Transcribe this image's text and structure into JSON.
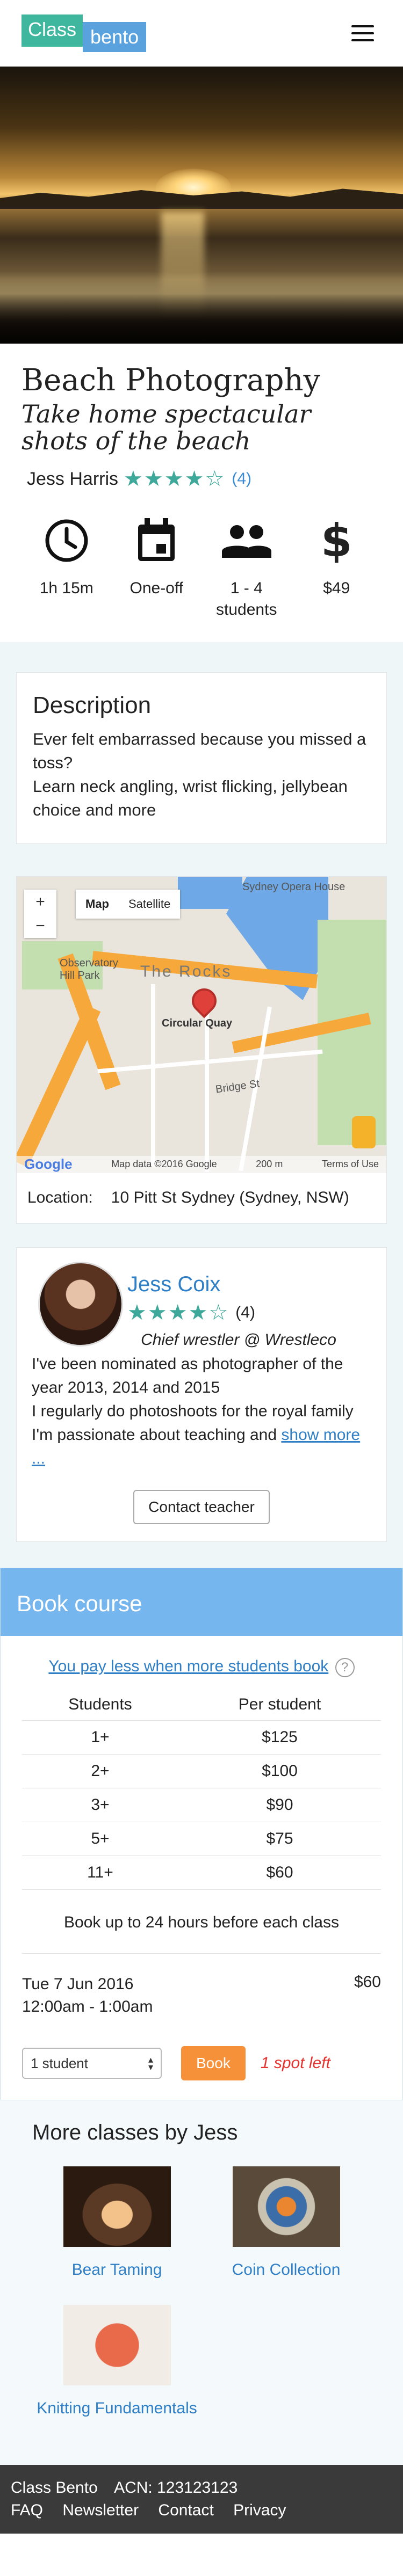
{
  "header": {
    "logo_part1": "Class",
    "logo_part2": "bento"
  },
  "course": {
    "title": "Beach Photography",
    "subtitle": "Take home spectacular shots of the beach",
    "teacher": "Jess Harris",
    "stars": "★★★★☆",
    "rating_count": "(4)"
  },
  "facts": [
    {
      "icon": "clock-icon",
      "text": "1h 15m"
    },
    {
      "icon": "calendar-icon",
      "text": "One-off"
    },
    {
      "icon": "people-icon",
      "text": "1 - 4 students"
    },
    {
      "icon": "dollar-icon",
      "text": "$49"
    }
  ],
  "description": {
    "heading": "Description",
    "text1": "Ever felt embarrassed because you missed a toss?",
    "text2": "Learn neck angling, wrist flicking, jellybean choice and more"
  },
  "map": {
    "type_map": "Map",
    "type_satellite": "Satellite",
    "labels": {
      "opera": "Sydney Opera House",
      "rocks": "The Rocks",
      "quay": "Circular Quay",
      "observatory": "Observatory Hill Park",
      "bridge": "Bridge St",
      "google": "Google",
      "data": "Map data ©2016 Google",
      "scale": "200 m",
      "terms": "Terms of Use"
    },
    "location_label": "Location:",
    "location_value": "10 Pitt St Sydney  (Sydney, NSW)"
  },
  "bio": {
    "name": "Jess Coix",
    "stars": "★★★★☆",
    "rating_count": "(4)",
    "role": "Chief wrestler @ Wrestleco",
    "line1": "I've been nominated as photographer of the year 2013, 2014 and 2015",
    "line2": "I regularly do photoshoots for the royal family",
    "line3": "I'm passionate about teaching and ",
    "show_more": "show more ...",
    "contact": "Contact teacher"
  },
  "booking": {
    "heading": "Book course",
    "pay_less": "You pay less when more students book",
    "help": "?",
    "col_students": "Students",
    "col_price": "Per student",
    "rows": [
      {
        "students": "1+",
        "price": "$125"
      },
      {
        "students": "2+",
        "price": "$100"
      },
      {
        "students": "3+",
        "price": "$90"
      },
      {
        "students": "5+",
        "price": "$75"
      },
      {
        "students": "11+",
        "price": "$60"
      }
    ],
    "notice": "Book up to 24 hours before each class",
    "session_date": "Tue 7 Jun 2016",
    "session_time": "12:00am - 1:00am",
    "session_price": "$60",
    "select_value": "1 student",
    "book_label": "Book",
    "spots": "1 spot left"
  },
  "more": {
    "heading": "More classes by Jess",
    "items": [
      {
        "label": "Bear Taming"
      },
      {
        "label": "Coin Collection"
      },
      {
        "label": "Knitting Fundamentals"
      }
    ]
  },
  "footer": {
    "company": "Class Bento",
    "acn": "ACN: 123123123",
    "links": [
      "FAQ",
      "Newsletter",
      "Contact",
      "Privacy"
    ]
  }
}
